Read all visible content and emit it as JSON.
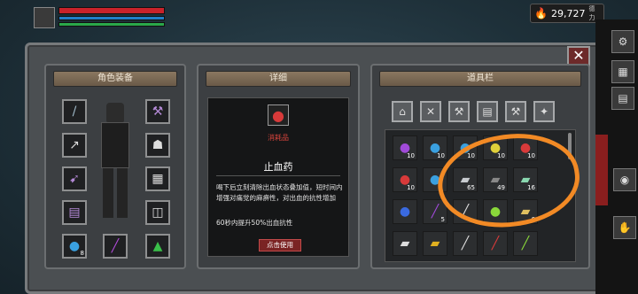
{
  "currency": {
    "amount": "29,727",
    "unit": "德力"
  },
  "panels": {
    "equipment_title": "角色装备",
    "detail_title": "详细",
    "inventory_title": "道具栏"
  },
  "detail": {
    "category": "消耗品",
    "name": "止血药",
    "desc": "喝下后立刻清除出血状态叠加值，短时间内增强对痛觉的麻痹性，对出血的抗性增加",
    "effect": "60秒内提升50%出血抗性",
    "use_button": "点击使用"
  },
  "equipment_slots": [
    {
      "icon": "/",
      "color": "#9fb8c8"
    },
    {
      "icon": "⚒",
      "color": "#b58ad8"
    },
    {
      "icon": "↗",
      "color": "#ddd"
    },
    {
      "icon": "☗",
      "color": "#ddd"
    },
    {
      "icon": "➹",
      "color": "#b58ad8"
    },
    {
      "icon": "▦",
      "color": "#ddd"
    },
    {
      "icon": "▤",
      "color": "#b58ad8"
    },
    {
      "icon": "◫",
      "color": "#ddd"
    },
    {
      "icon": "●",
      "color": "#3aa0e0",
      "count": "8"
    },
    {
      "icon": "╱",
      "color": "#b04ad8"
    },
    {
      "icon": "▲",
      "color": "#3ac04a"
    }
  ],
  "inventory_tabs": [
    "⌂",
    "✕",
    "⚒",
    "▤",
    "⚒",
    "✦"
  ],
  "inventory": [
    {
      "icon": "●",
      "color": "#a04ad8",
      "count": "10"
    },
    {
      "icon": "●",
      "color": "#3aa0e0",
      "count": "10"
    },
    {
      "icon": "●",
      "color": "#3aa0e0",
      "count": "10"
    },
    {
      "icon": "●",
      "color": "#e0d03a",
      "count": "10"
    },
    {
      "icon": "●",
      "color": "#d83a3a",
      "count": "10"
    },
    {
      "icon": "●",
      "color": "#d83a3a",
      "count": "10"
    },
    {
      "icon": "●",
      "color": "#3aa0e0",
      "count": ""
    },
    {
      "icon": "▰",
      "color": "#c8ccd0",
      "count": "65"
    },
    {
      "icon": "▰",
      "color": "#888",
      "count": "49"
    },
    {
      "icon": "▰",
      "color": "#8ad8b0",
      "count": "16"
    },
    {
      "icon": "●",
      "color": "#3a6ae0",
      "count": ""
    },
    {
      "icon": "╱",
      "color": "#a04ad8",
      "count": "5"
    },
    {
      "icon": "╱",
      "color": "#ddd",
      "count": ""
    },
    {
      "icon": "●",
      "color": "#8ad83a",
      "count": ""
    },
    {
      "icon": "▰",
      "color": "#e0c060",
      "count": "6"
    },
    {
      "icon": "▰",
      "color": "#ddd",
      "count": ""
    },
    {
      "icon": "▰",
      "color": "#e0b020",
      "count": ""
    },
    {
      "icon": "╱",
      "color": "#ddd",
      "count": ""
    },
    {
      "icon": "╱",
      "color": "#d83a3a",
      "count": ""
    },
    {
      "icon": "╱",
      "color": "#8ad83a",
      "count": ""
    }
  ]
}
